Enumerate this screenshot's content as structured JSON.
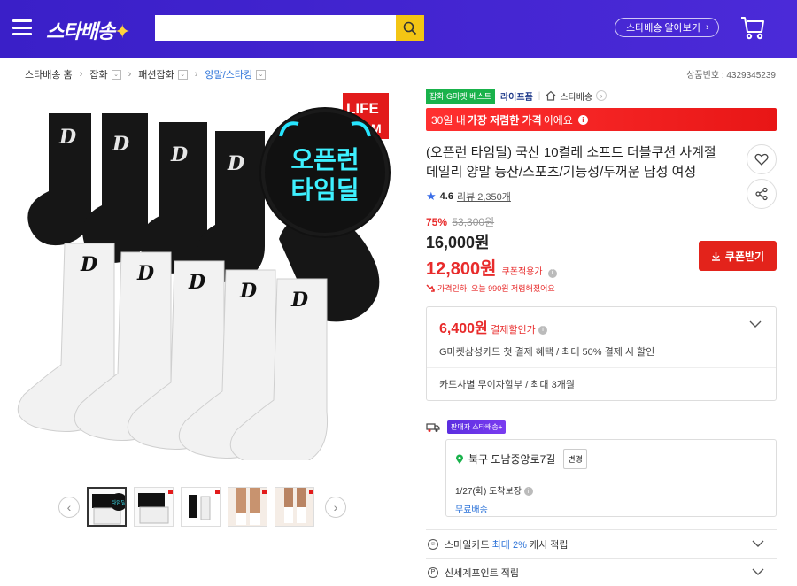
{
  "header": {
    "logo_text": "스타배송",
    "logo_star": "✦",
    "search_placeholder": "",
    "about_label": "스타배송 알아보기"
  },
  "breadcrumb": {
    "items": [
      {
        "label": "스타배송 홈"
      },
      {
        "label": "잡화"
      },
      {
        "label": "패션잡화"
      },
      {
        "label": "양말/스타킹"
      }
    ],
    "product_number": "상품번호 : 4329345239"
  },
  "image": {
    "badge_line1": "오픈런",
    "badge_line2": "타임딜",
    "corner_tag": "LIFE\nFARM",
    "sock_letter": "D"
  },
  "product": {
    "tag_badge": "잡화 G마켓 베스트",
    "brand": "라이프폼",
    "store": "스타배송",
    "banner_pre": "30일 내 ",
    "banner_bold": "가장 저렴한 가격",
    "banner_post": "이에요",
    "title": "(오픈런 타임딜) 국산 10켤레 소프트 더블쿠션 사계절 데일리 양말 등산/스포츠/기능성/두꺼운 남성 여성",
    "rating": "4.6",
    "reviews": "리뷰 2,350개",
    "discount_pct": "75%",
    "orig_price": "53,300원",
    "price": "16,000원",
    "coupon_price": "12,800원",
    "coupon_label": "쿠폰적용가",
    "price_down": "가격인하! 오늘 990원 저렴해졌어요",
    "coupon_btn": "쿠폰받기"
  },
  "card_discount": {
    "price": "6,400원",
    "label": "결제할인가",
    "desc": "G마켓삼성카드 첫 결제 혜택 / 최대 50% 결제 시 할인",
    "installment": "카드사별 무이자할부 / 최대 3개월"
  },
  "shipping": {
    "badge": "판매자 스타배송+",
    "address": "북구 도남중앙로7길",
    "change_label": "변경",
    "arrival": "1/27(화) 도착보장",
    "free": "무료배송"
  },
  "benefits": [
    {
      "pre": "스마일카드 ",
      "hl": "최대 2%",
      "post": " 캐시 적립"
    },
    {
      "pre": "신세계포인트 적립",
      "hl": "",
      "post": ""
    }
  ],
  "colors": {
    "header": "#3a1fc8",
    "search_button": "#f3c514",
    "red": "#e82b2b",
    "blue_link": "#2b72d8"
  }
}
